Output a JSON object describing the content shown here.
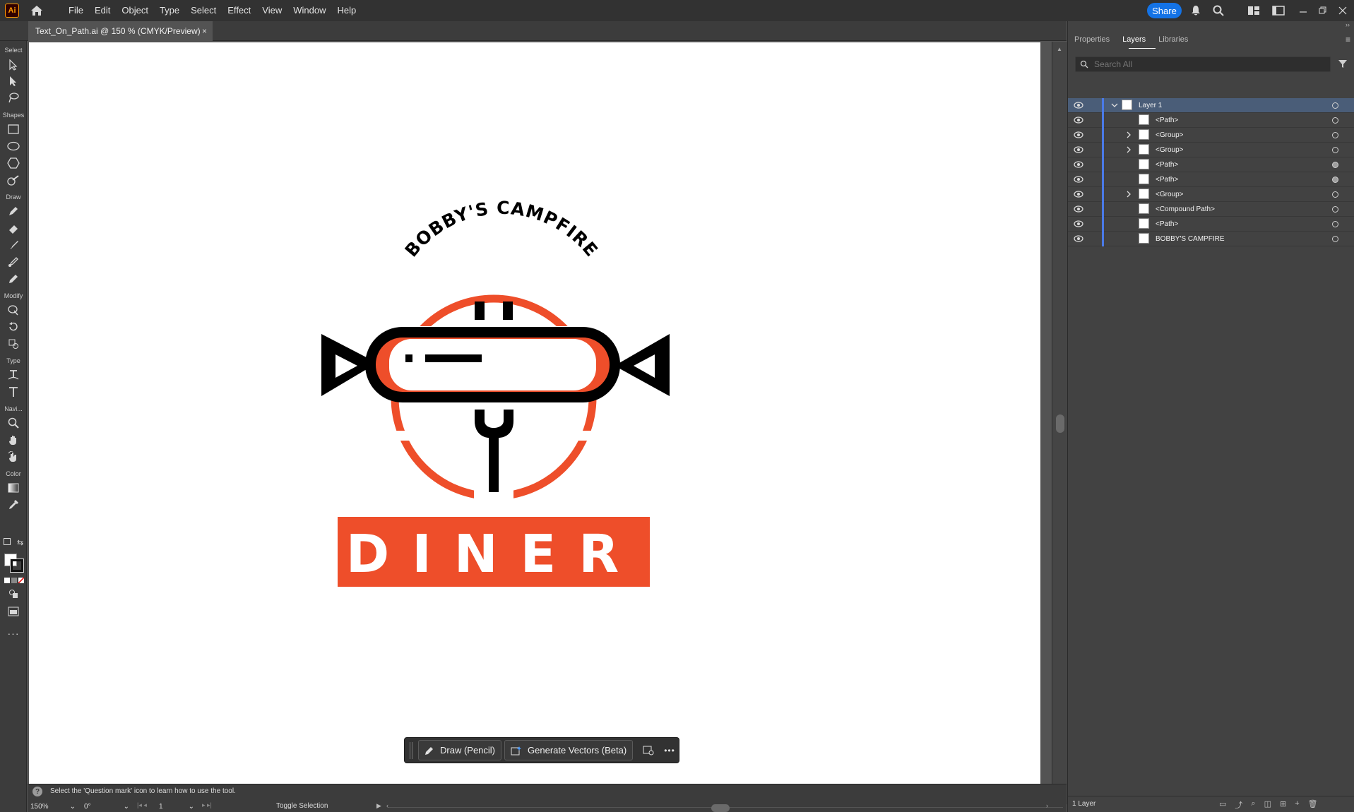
{
  "app": {
    "logo_text": "Ai"
  },
  "menu": [
    "File",
    "Edit",
    "Object",
    "Type",
    "Select",
    "Effect",
    "View",
    "Window",
    "Help"
  ],
  "share_label": "Share",
  "document": {
    "tab_title": "Text_On_Path.ai @ 150 % (CMYK/Preview)",
    "close_glyph": "×"
  },
  "toolbar_sections": [
    "Select",
    "Shapes",
    "Draw",
    "Modify",
    "Type",
    "Navi...",
    "Color"
  ],
  "artwork": {
    "arc_text": "BOBBY'S CAMPFIRE",
    "diner_text": "DINER",
    "colors": {
      "orange": "#ee4e2a",
      "black": "#000000",
      "white": "#ffffff"
    }
  },
  "taskbar": {
    "draw_label": "Draw (Pencil)",
    "generate_label": "Generate Vectors (Beta)",
    "more_glyph": "•••"
  },
  "status": {
    "help_text": "Select the 'Question mark' icon to learn how to use the tool.",
    "zoom": "150%",
    "rotation": "0°",
    "artboard_num": "1",
    "toggle_label": "Toggle Selection"
  },
  "panel": {
    "tabs": [
      "Properties",
      "Layers",
      "Libraries"
    ],
    "active_tab": "Layers",
    "search_placeholder": "Search All",
    "layers": [
      {
        "name": "Layer 1",
        "expanded": true,
        "selected": true
      },
      {
        "name": "<Path>"
      },
      {
        "name": "<Group>",
        "has_children": true
      },
      {
        "name": "<Group>",
        "has_children": true
      },
      {
        "name": "<Path>",
        "target_filled": true
      },
      {
        "name": "<Path>",
        "target_filled": true
      },
      {
        "name": "<Group>",
        "has_children": true
      },
      {
        "name": "<Compound Path>"
      },
      {
        "name": "<Path>"
      },
      {
        "name": "BOBBY'S CAMPFIRE"
      }
    ],
    "footer_text": "1 Layer"
  }
}
